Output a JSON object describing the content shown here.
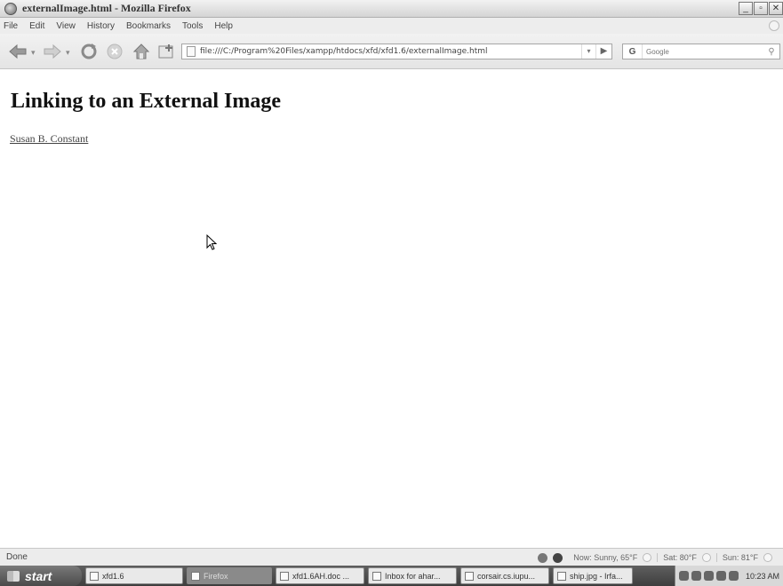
{
  "window": {
    "title": "externalImage.html - Mozilla Firefox",
    "minimize": "_",
    "maximize": "▫",
    "close": "✕"
  },
  "menu": [
    "File",
    "Edit",
    "View",
    "History",
    "Bookmarks",
    "Tools",
    "Help"
  ],
  "toolbar": {
    "url": "file:///C:/Program%20Files/xampp/htdocs/xfd/xfd1.6/externalImage.html",
    "search_placeholder": "Google",
    "search_engine": "G"
  },
  "page": {
    "heading": "Linking to an External Image",
    "link_text": "Susan B. Constant"
  },
  "status": {
    "text": "Done",
    "weather_now": "Now: Sunny, 65°F",
    "weather_sat": "Sat: 80°F",
    "weather_sun": "Sun: 81°F"
  },
  "taskbar": {
    "start_label": "start",
    "tasks": [
      "xfd1.6",
      "Firefox",
      "xfd1.6AH.doc ...",
      "Inbox for ahar...",
      "corsair.cs.iupu...",
      "ship.jpg - Irfa..."
    ],
    "clock": "10:23 AM"
  }
}
